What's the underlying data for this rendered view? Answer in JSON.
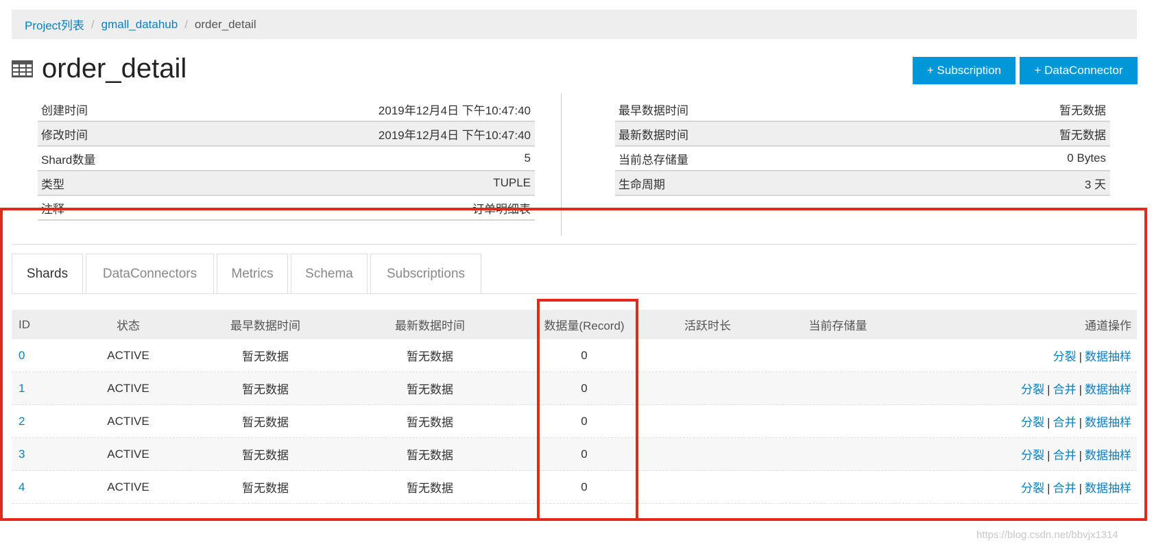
{
  "breadcrumb": {
    "project_list": "Project列表",
    "project": "gmall_datahub",
    "current": "order_detail",
    "separator": "/"
  },
  "header": {
    "title": "order_detail",
    "icon": "table-icon",
    "subscription_button": "+ Subscription",
    "dataconnector_button": "+ DataConnector"
  },
  "info_left": [
    {
      "label": "创建时间",
      "value": "2019年12月4日 下午10:47:40"
    },
    {
      "label": "修改时间",
      "value": "2019年12月4日 下午10:47:40"
    },
    {
      "label": "Shard数量",
      "value": "5"
    },
    {
      "label": "类型",
      "value": "TUPLE"
    },
    {
      "label": "注释",
      "value": "订单明细表"
    }
  ],
  "info_right": [
    {
      "label": "最早数据时间",
      "value": "暂无数据"
    },
    {
      "label": "最新数据时间",
      "value": "暂无数据"
    },
    {
      "label": "当前总存储量",
      "value": "0 Bytes"
    },
    {
      "label": "生命周期",
      "value": "3 天"
    }
  ],
  "tabs": [
    "Shards",
    "DataConnectors",
    "Metrics",
    "Schema",
    "Subscriptions"
  ],
  "active_tab": "Shards",
  "shards_table": {
    "columns": [
      "ID",
      "状态",
      "最早数据时间",
      "最新数据时间",
      "数据量(Record)",
      "活跃时长",
      "当前存储量",
      "通道操作"
    ],
    "rows": [
      {
        "id": "0",
        "state": "ACTIVE",
        "earliest": "暂无数据",
        "latest": "暂无数据",
        "records": "0",
        "active_time": "",
        "storage": "",
        "ops": [
          "分裂",
          "数据抽样"
        ]
      },
      {
        "id": "1",
        "state": "ACTIVE",
        "earliest": "暂无数据",
        "latest": "暂无数据",
        "records": "0",
        "active_time": "",
        "storage": "",
        "ops": [
          "分裂",
          "合并",
          "数据抽样"
        ]
      },
      {
        "id": "2",
        "state": "ACTIVE",
        "earliest": "暂无数据",
        "latest": "暂无数据",
        "records": "0",
        "active_time": "",
        "storage": "",
        "ops": [
          "分裂",
          "合并",
          "数据抽样"
        ]
      },
      {
        "id": "3",
        "state": "ACTIVE",
        "earliest": "暂无数据",
        "latest": "暂无数据",
        "records": "0",
        "active_time": "",
        "storage": "",
        "ops": [
          "分裂",
          "合并",
          "数据抽样"
        ]
      },
      {
        "id": "4",
        "state": "ACTIVE",
        "earliest": "暂无数据",
        "latest": "暂无数据",
        "records": "0",
        "active_time": "",
        "storage": "",
        "ops": [
          "分裂",
          "合并",
          "数据抽样"
        ]
      }
    ]
  },
  "watermark": "https://blog.csdn.net/bbvjx1314",
  "colors": {
    "link": "#0b7fbf",
    "button": "#0097d9",
    "annotation": "#e02a1c"
  }
}
